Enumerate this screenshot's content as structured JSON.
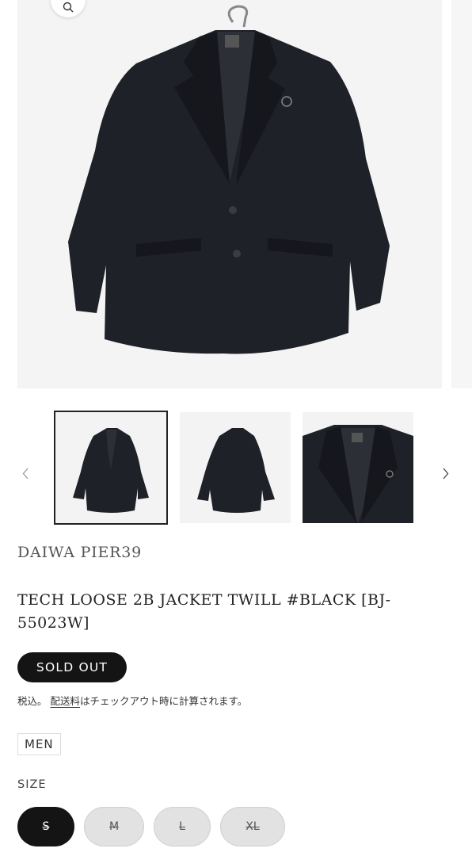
{
  "gallery": {
    "zoom_icon": "search-icon",
    "prev_icon": "chevron-left-icon",
    "next_icon": "chevron-right-icon",
    "active_thumbnail_index": 0,
    "thumbnails": [
      "front",
      "back",
      "detail"
    ]
  },
  "product": {
    "brand": "DAIWA PIER39",
    "title": "TECH LOOSE 2B JACKET TWILL #BLACK [BJ-55023W]",
    "status_badge": "SOLD OUT",
    "tax_prefix": "税込。",
    "tax_link": "配送料",
    "tax_suffix": "はチェックアウト時に計算されます。",
    "tag": "MEN"
  },
  "size_selector": {
    "label": "SIZE",
    "selected": "S",
    "options": [
      "S",
      "M",
      "L",
      "XL"
    ]
  },
  "colors": {
    "accent": "#141414",
    "unselected_pill": "#e2e2e2",
    "jacket": "#1e2128"
  }
}
